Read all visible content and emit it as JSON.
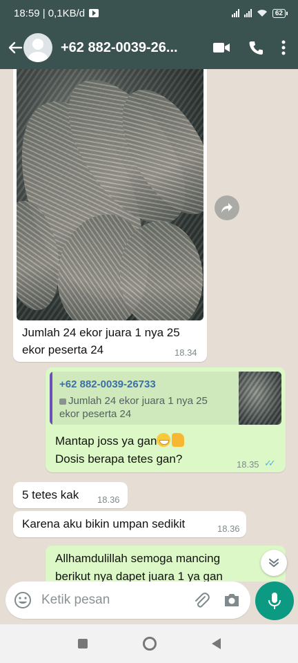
{
  "status": {
    "time_speed": "18:59 | 0,1KB/d",
    "battery": "62"
  },
  "header": {
    "contact": "+62 882-0039-26..."
  },
  "messages": {
    "m1_text_line1": "Jumlah 24 ekor juara 1 nya 25",
    "m1_text_line2": "ekor peserta 24",
    "m1_time": "18.34",
    "reply_name": "+62 882-0039-26733",
    "reply_text_line1": "Jumlah 24 ekor juara 1 nya 25",
    "reply_text_line2": "ekor peserta 24",
    "m2_text_line1": "Mantap joss ya gan",
    "m2_text_line2": "Dosis berapa tetes gan?",
    "m2_time": "18.35",
    "m3_text": "5 tetes kak",
    "m3_time": "18.36",
    "m4_text": "Karena aku bikin umpan sedikit",
    "m4_time": "18.36",
    "m5_text_line1": "Allhamdulillah semoga mancing",
    "m5_text_line2": "berikut nya dapet juara 1 ya gan"
  },
  "composer": {
    "placeholder": "Ketik pesan"
  },
  "colors": {
    "header": "#3b5350",
    "outgoing": "#dcf8c6",
    "incoming": "#ffffff",
    "background": "#e6ded5",
    "accent": "#0c9a82"
  },
  "icons": [
    "back-arrow-icon",
    "avatar-icon",
    "video-call-icon",
    "phone-icon",
    "more-vert-icon",
    "forward-icon",
    "double-check-icon",
    "scroll-down-icon",
    "emoji-icon",
    "attach-icon",
    "camera-icon",
    "mic-icon",
    "nav-recent-icon",
    "nav-home-icon",
    "nav-back-icon"
  ]
}
